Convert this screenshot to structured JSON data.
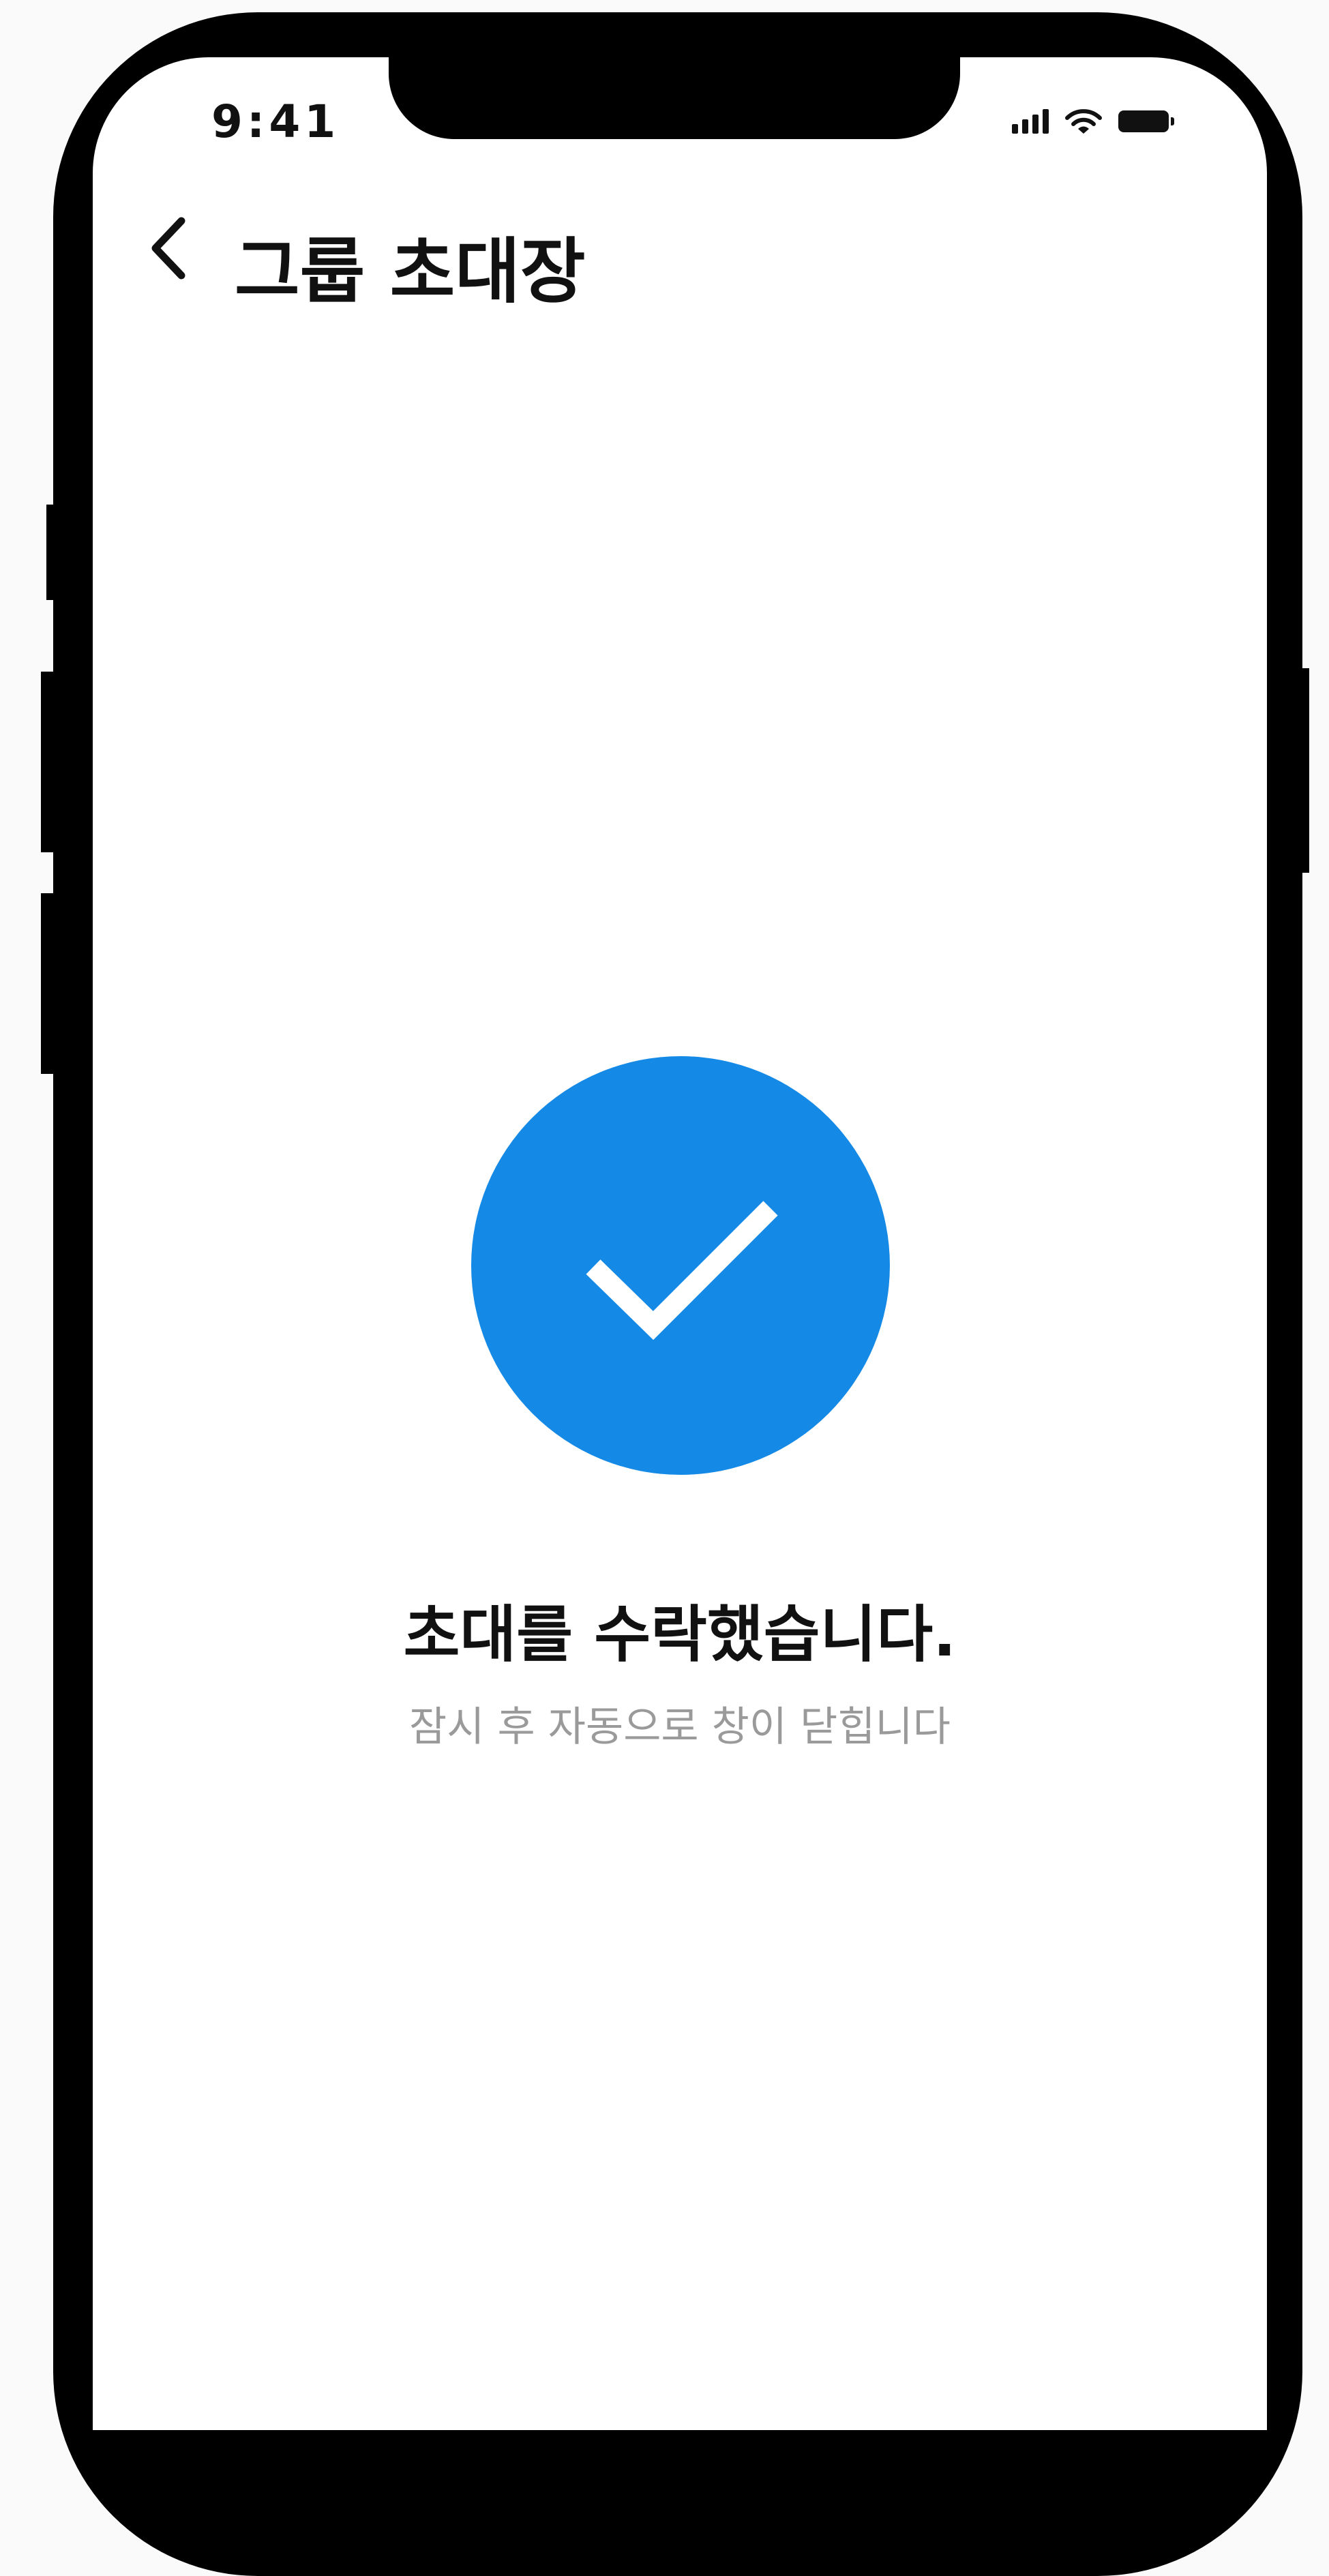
{
  "status_bar": {
    "time": "9:41",
    "icons": [
      "cellular-signal-icon",
      "wifi-icon",
      "battery-icon"
    ]
  },
  "header": {
    "back_icon": "chevron-left-icon",
    "title": "그룹 초대장"
  },
  "confirmation": {
    "icon": "checkmark-icon",
    "title": "초대를 수락했습니다.",
    "subtitle": "잠시 후 자동으로 창이 닫힙니다"
  },
  "colors": {
    "accent": "#1589E6",
    "primary_text": "#111111",
    "secondary_text": "#9A9A9A"
  }
}
